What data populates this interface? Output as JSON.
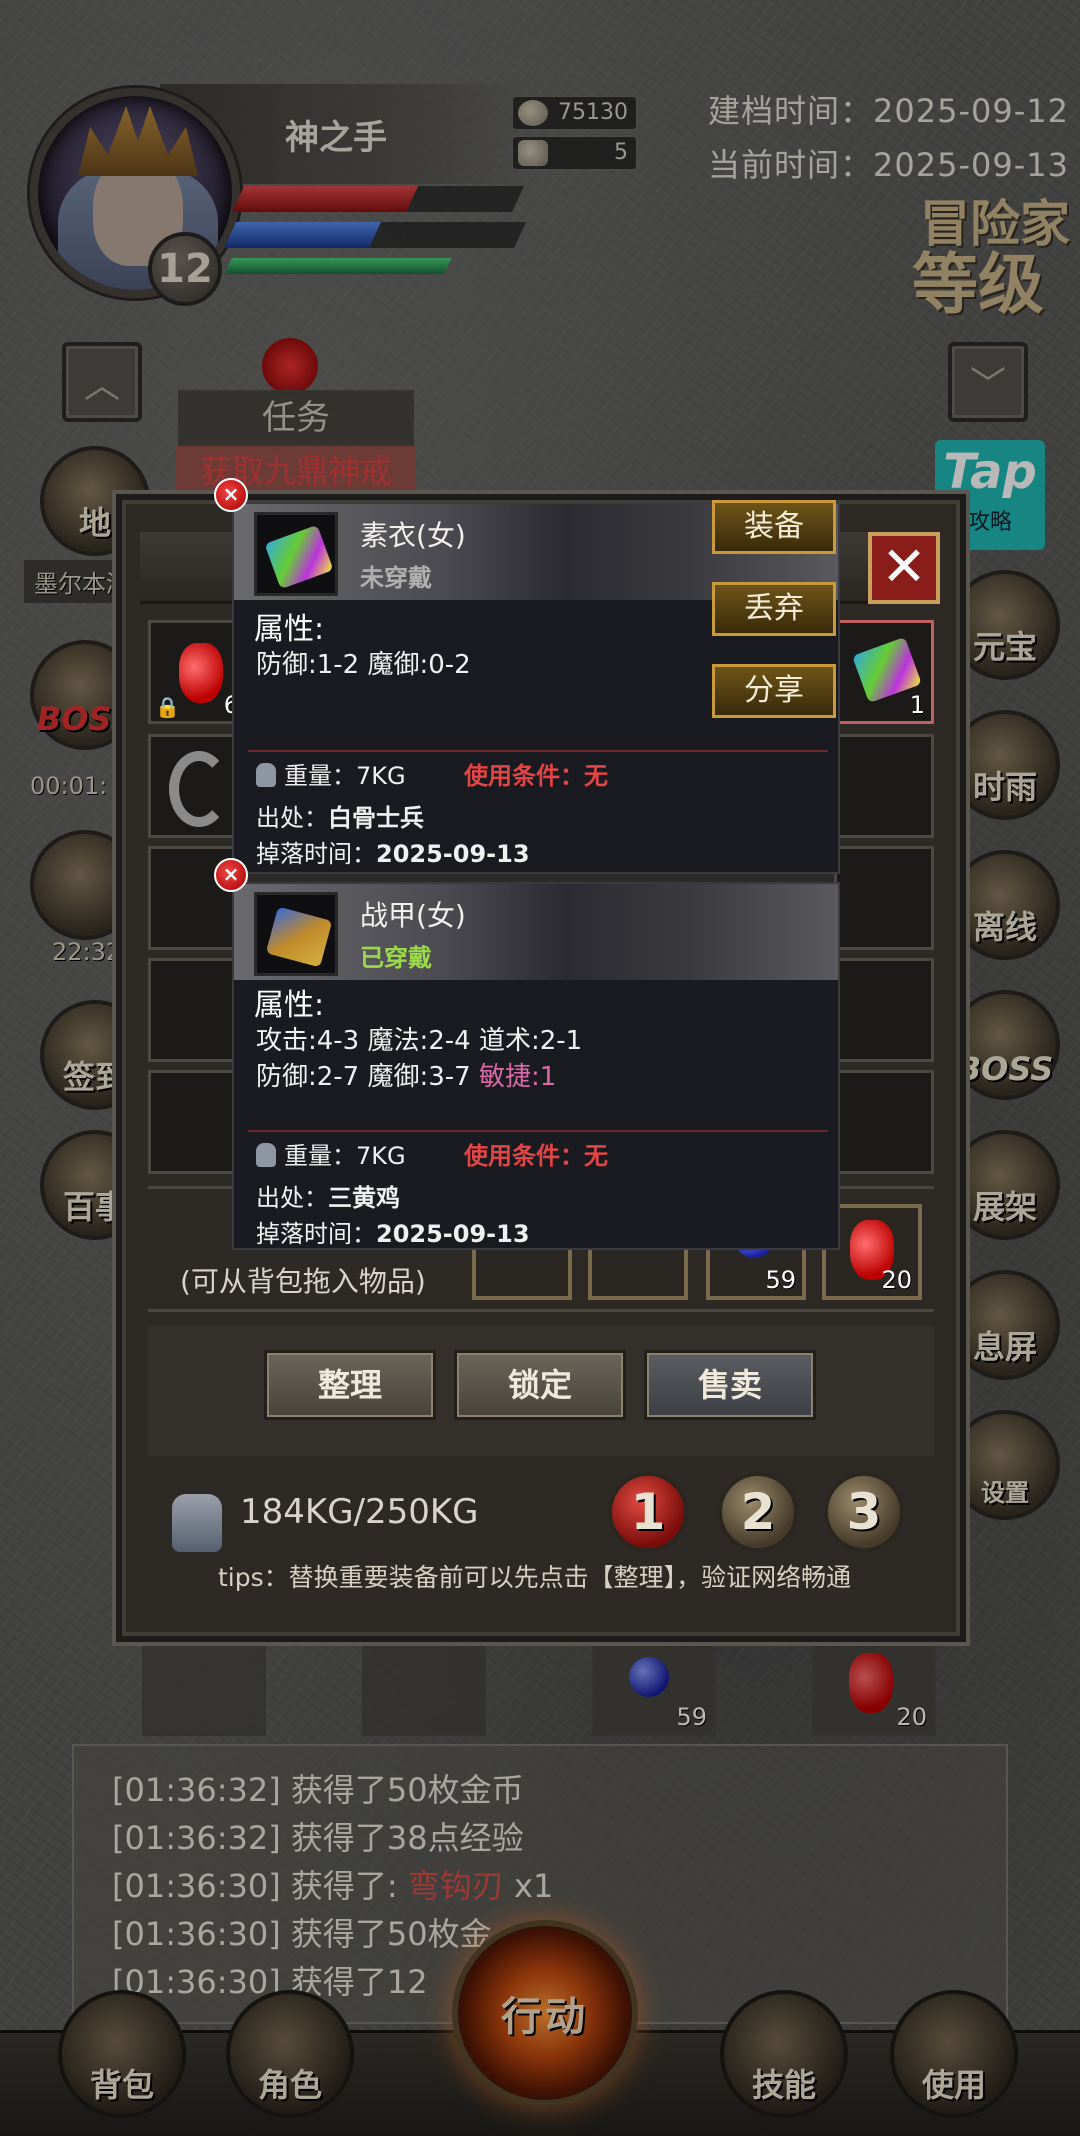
{
  "player": {
    "name": "神之手",
    "level": "12",
    "gold": "75130",
    "silver": "5"
  },
  "dates": {
    "created_label": "建档时间：",
    "created_value": "2025-09-12",
    "current_label": "当前时间：",
    "current_value": "2025-09-13"
  },
  "adventurer_level": {
    "line1": "冒险家",
    "line2": "等级"
  },
  "task": {
    "title": "任务",
    "subtitle": "获取九鼎神戒"
  },
  "tap_badge": {
    "logo": "Tap",
    "sub": "攻略"
  },
  "side_left": [
    {
      "label": "地"
    },
    {
      "label": "墨尔本湘"
    },
    {
      "label": "BOSS",
      "timer": "00:01:"
    },
    {
      "timer": "22:32"
    },
    {
      "label": "签到"
    },
    {
      "label": "百事"
    }
  ],
  "side_right": [
    {
      "label": "元宝"
    },
    {
      "label": "时雨"
    },
    {
      "label": "离线"
    },
    {
      "label": "BOSS"
    },
    {
      "label": "展架"
    },
    {
      "label": "息屏"
    },
    {
      "label": "设置"
    }
  ],
  "bag": {
    "top_row": [
      {
        "icon": "red-potion-icon",
        "count": "6",
        "locked": true
      },
      {
        "icon": "armor-icon",
        "count": "1"
      }
    ],
    "drag_hint": "(可从背包拖入物品)",
    "quick_slots": [
      {
        "icon": "",
        "count": ""
      },
      {
        "icon": "",
        "count": ""
      },
      {
        "icon": "blue-potion-icon",
        "count": "59"
      },
      {
        "icon": "red-potion-icon",
        "count": "20"
      }
    ],
    "buttons": {
      "sort": "整理",
      "lock": "锁定",
      "sell": "售卖"
    },
    "weight": "184KG/250KG",
    "pages": [
      "1",
      "2",
      "3"
    ],
    "tips": "tips：替换重要装备前可以先点击【整理】，验证网络畅通"
  },
  "tooltip_new": {
    "name": "素衣(女)",
    "state": "未穿戴",
    "state_color": "#b0b0b0",
    "attr_title": "属性:",
    "attr_line1": "防御:1-2  魔御:0-2",
    "weight_label": "重量：7KG",
    "req_label": "使用条件：无",
    "source_label": "出处：",
    "source_value": "白骨士兵",
    "drop_label": "掉落时间：",
    "drop_value": "2025-09-13"
  },
  "tooltip_worn": {
    "name": "战甲(女)",
    "state": "已穿戴",
    "state_color": "#9bd94a",
    "attr_title": "属性:",
    "attr_line1": "攻击:4-3  魔法:2-4  道术:2-1",
    "attr_line2a": "防御:2-7  魔御:3-7  ",
    "attr_line2b": "敏捷:1",
    "weight_label": "重量：7KG",
    "req_label": "使用条件：无",
    "source_label": "出处：",
    "source_value": "三黄鸡",
    "drop_label": "掉落时间：",
    "drop_value": "2025-09-13"
  },
  "tooltip_actions": {
    "equip": "装备",
    "discard": "丢弃",
    "share": "分享"
  },
  "under_row": [
    {
      "count": ""
    },
    {
      "count": ""
    },
    {
      "icon": "blue-potion-icon",
      "count": "59"
    },
    {
      "icon": "red-potion-icon",
      "count": "20"
    }
  ],
  "log": [
    {
      "time": "[01:36:32]",
      "text": " 获得了50枚金币",
      "item": "",
      "suffix": ""
    },
    {
      "time": "[01:36:32]",
      "text": " 获得了38点经验",
      "item": "",
      "suffix": ""
    },
    {
      "time": "[01:36:30]",
      "text": " 获得了: ",
      "item": "弯钩刃",
      "suffix": " x1"
    },
    {
      "time": "[01:36:30]",
      "text": " 获得了50枚金",
      "item": "",
      "suffix": ""
    },
    {
      "time": "[01:36:30]",
      "text": " 获得了12",
      "item": "",
      "suffix": ""
    }
  ],
  "bottom_nav": {
    "bag": "背包",
    "role": "角色",
    "action": "行动",
    "skill": "技能",
    "use": "使用"
  },
  "colors": {
    "hp": "#c0282e",
    "mp": "#2a5fd0",
    "xp": "#2aa060",
    "accent_gold": "#c99a3a"
  }
}
